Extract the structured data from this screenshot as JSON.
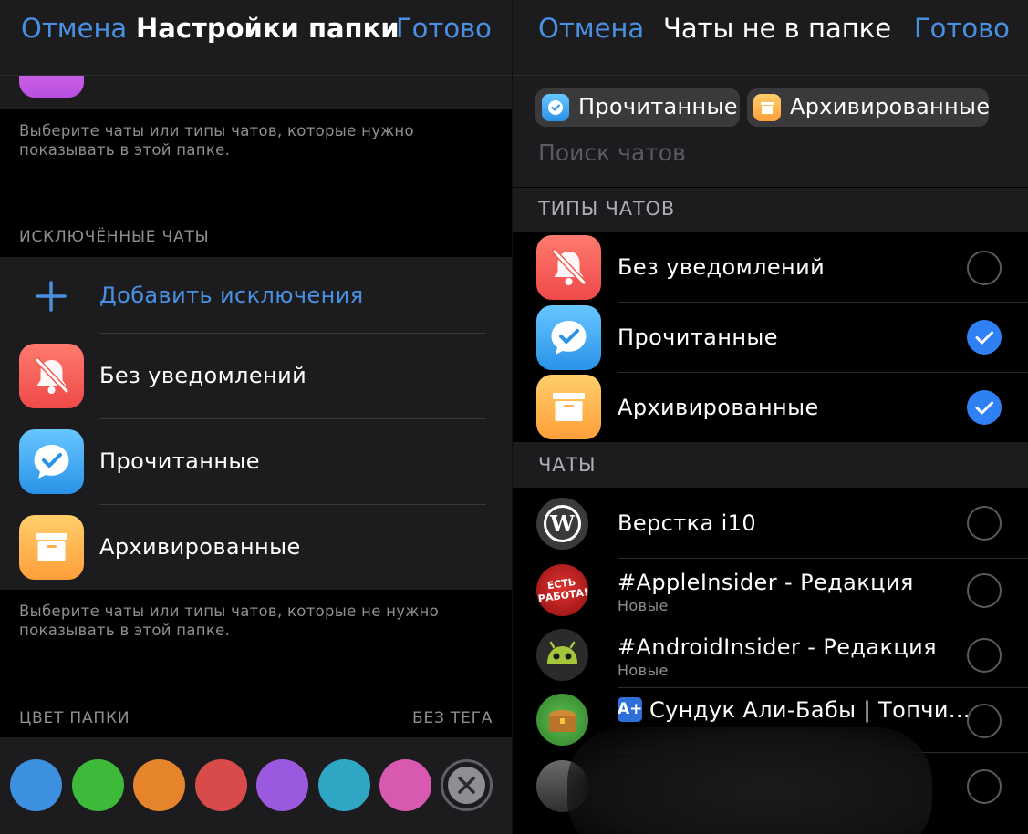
{
  "left": {
    "nav": {
      "cancel": "Отмена",
      "title": "Настройки папки",
      "done": "Готово"
    },
    "included_footnote": "Выберите чаты или типы чатов, которые нужно показывать в этой папке.",
    "excluded_header": "ИСКЛЮЧЁННЫЕ ЧАТЫ",
    "add_exceptions": "Добавить исключения",
    "excluded_items": [
      {
        "label": "Без уведомлений",
        "icon": "bell-slash-icon"
      },
      {
        "label": "Прочитанные",
        "icon": "checkmark-bubble-icon"
      },
      {
        "label": "Архивированные",
        "icon": "archive-box-icon"
      }
    ],
    "excluded_footnote": "Выберите чаты или типы чатов, которые не нужно показывать в этой папке.",
    "color_header": "ЦВЕТ ПАПКИ",
    "color_value": "БЕЗ ТЕГА",
    "colors": [
      "#3d8fe0",
      "#3dba3a",
      "#e6842c",
      "#d94b4b",
      "#9b59e0",
      "#2ea6c4",
      "#d85ab0"
    ]
  },
  "right": {
    "nav": {
      "cancel": "Отмена",
      "title": "Чаты не в папке",
      "done": "Готово"
    },
    "chips": [
      {
        "label": "Прочитанные",
        "icon": "checkmark-bubble-icon"
      },
      {
        "label": "Архивированные",
        "icon": "archive-box-icon"
      }
    ],
    "search_placeholder": "Поиск чатов",
    "types_header": "ТИПЫ ЧАТОВ",
    "types": [
      {
        "label": "Без уведомлений",
        "selected": false
      },
      {
        "label": "Прочитанные",
        "selected": true
      },
      {
        "label": "Архивированные",
        "selected": true
      }
    ],
    "chats_header": "ЧАТЫ",
    "chats": [
      {
        "name": "Верстка i10",
        "sub": "",
        "avatar": "wordpress-logo"
      },
      {
        "name": "#AppleInsider - Редакция",
        "sub": "Новые",
        "avatar_text": "ЕСТЬ РАБОТА!"
      },
      {
        "name": "#AndroidInsider - Редакция",
        "sub": "Новые",
        "avatar": "android-face"
      },
      {
        "name": "Сундук Али-Бабы | Топчи...",
        "sub": "",
        "avatar": "treasure-chest",
        "badge": "A+"
      }
    ]
  }
}
